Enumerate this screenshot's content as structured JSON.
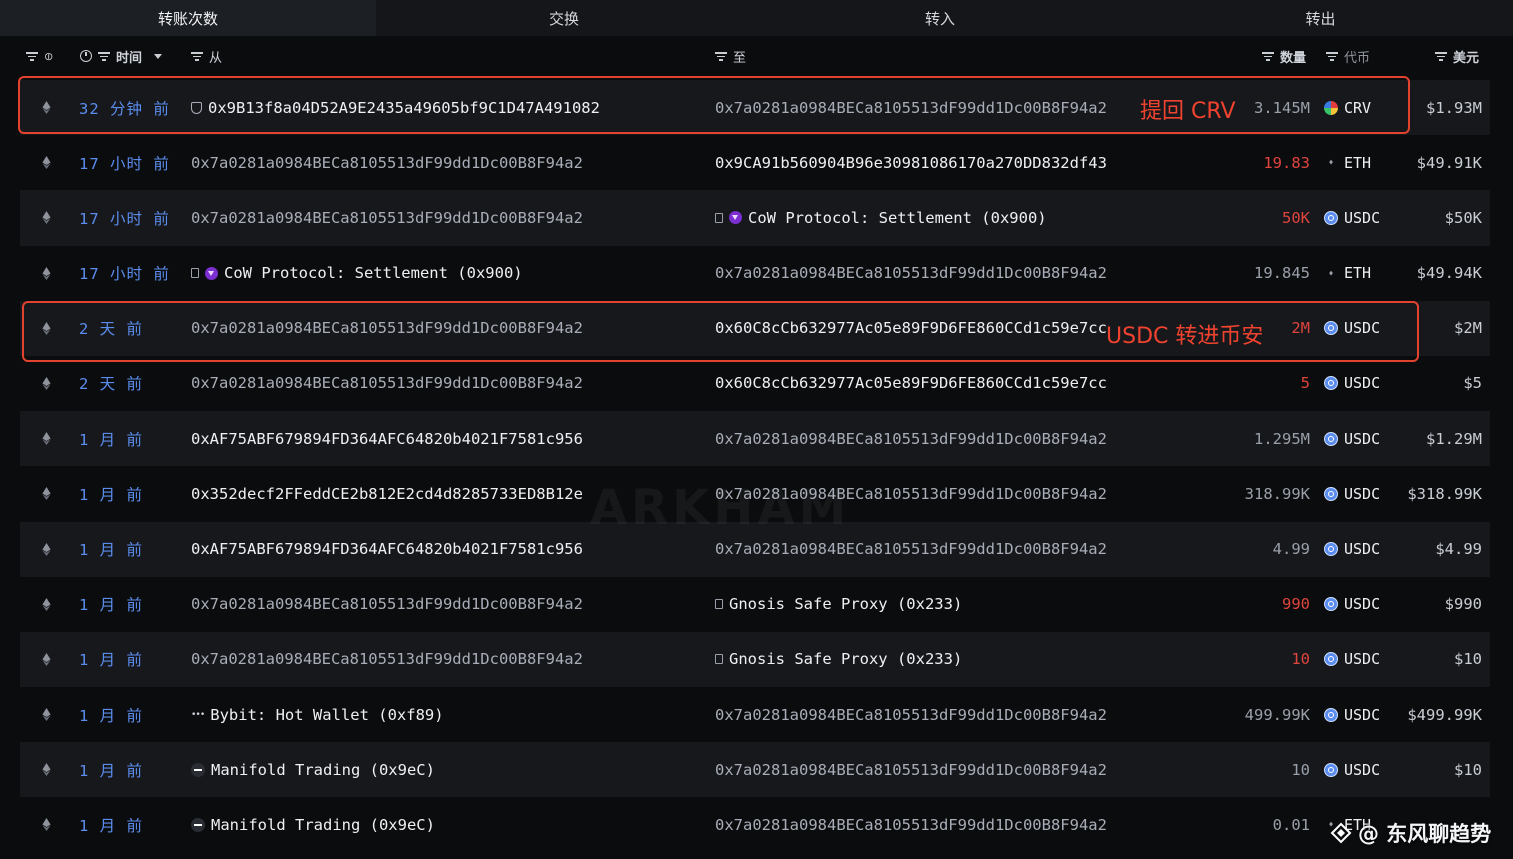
{
  "tabs": [
    "转账次数",
    "交换",
    "转入",
    "转出"
  ],
  "header": {
    "time": "时间",
    "from": "从",
    "to": "至",
    "amount": "数量",
    "token": "代币",
    "usd": "美元"
  },
  "rows": [
    {
      "time": "32 分钟 前",
      "from": "0x9B13f8a04D52A9E2435a49605bf9C1D47A491082",
      "to": "0x7a0281a0984BECa8105513dF99dd1Dc00B8F94a2",
      "amount": "3.145M",
      "token": "CRV",
      "usd": "$1.93M"
    },
    {
      "time": "17 小时 前",
      "from": "0x7a0281a0984BECa8105513dF99dd1Dc00B8F94a2",
      "to": "0x9CA91b560904B96e30981086170a270DD832df43",
      "amount": "19.83",
      "token": "ETH",
      "usd": "$49.91K"
    },
    {
      "time": "17 小时 前",
      "from": "0x7a0281a0984BECa8105513dF99dd1Dc00B8F94a2",
      "to": "CoW Protocol: Settlement (0x900)",
      "amount": "50K",
      "token": "USDC",
      "usd": "$50K"
    },
    {
      "time": "17 小时 前",
      "from": "CoW Protocol: Settlement (0x900)",
      "to": "0x7a0281a0984BECa8105513dF99dd1Dc00B8F94a2",
      "amount": "19.845",
      "token": "ETH",
      "usd": "$49.94K"
    },
    {
      "time": "2 天 前",
      "from": "0x7a0281a0984BECa8105513dF99dd1Dc00B8F94a2",
      "to": "0x60C8cCb632977Ac05e89F9D6FE860CCd1c59e7cc",
      "amount": "2M",
      "token": "USDC",
      "usd": "$2M"
    },
    {
      "time": "2 天 前",
      "from": "0x7a0281a0984BECa8105513dF99dd1Dc00B8F94a2",
      "to": "0x60C8cCb632977Ac05e89F9D6FE860CCd1c59e7cc",
      "amount": "5",
      "token": "USDC",
      "usd": "$5"
    },
    {
      "time": "1 月 前",
      "from": "0xAF75ABF679894FD364AFC64820b4021F7581c956",
      "to": "0x7a0281a0984BECa8105513dF99dd1Dc00B8F94a2",
      "amount": "1.295M",
      "token": "USDC",
      "usd": "$1.29M"
    },
    {
      "time": "1 月 前",
      "from": "0x352decf2FFeddCE2b812E2cd4d8285733ED8B12e",
      "to": "0x7a0281a0984BECa8105513dF99dd1Dc00B8F94a2",
      "amount": "318.99K",
      "token": "USDC",
      "usd": "$318.99K"
    },
    {
      "time": "1 月 前",
      "from": "0xAF75ABF679894FD364AFC64820b4021F7581c956",
      "to": "0x7a0281a0984BECa8105513dF99dd1Dc00B8F94a2",
      "amount": "4.99",
      "token": "USDC",
      "usd": "$4.99"
    },
    {
      "time": "1 月 前",
      "from": "0x7a0281a0984BECa8105513dF99dd1Dc00B8F94a2",
      "to": "Gnosis Safe Proxy (0x233)",
      "amount": "990",
      "token": "USDC",
      "usd": "$990"
    },
    {
      "time": "1 月 前",
      "from": "0x7a0281a0984BECa8105513dF99dd1Dc00B8F94a2",
      "to": "Gnosis Safe Proxy (0x233)",
      "amount": "10",
      "token": "USDC",
      "usd": "$10"
    },
    {
      "time": "1 月 前",
      "from": "Bybit: Hot Wallet (0xf89)",
      "to": "0x7a0281a0984BECa8105513dF99dd1Dc00B8F94a2",
      "amount": "499.99K",
      "token": "USDC",
      "usd": "$499.99K"
    },
    {
      "time": "1 月 前",
      "from": "Manifold Trading (0x9eC)",
      "to": "0x7a0281a0984BECa8105513dF99dd1Dc00B8F94a2",
      "amount": "10",
      "token": "USDC",
      "usd": "$10"
    },
    {
      "time": "1 月 前",
      "from": "Manifold Trading (0x9eC)",
      "to": "0x7a0281a0984BECa8105513dF99dd1Dc00B8F94a2",
      "amount": "0.01",
      "token": "ETH",
      "usd": ""
    }
  ],
  "annotations": {
    "crv_note": "提回 CRV",
    "usdc_note": "USDC 转进币安"
  },
  "watermark": "ARKHAM",
  "brand": "@ 东风聊趋势",
  "colors": {
    "accent": "#5b8def",
    "highlight": "#e2432f",
    "negative": "#e0443e"
  }
}
